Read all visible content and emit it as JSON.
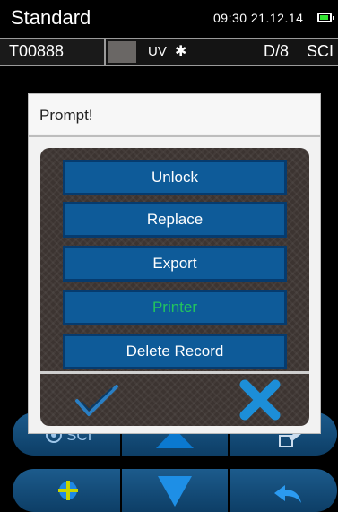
{
  "status": {
    "mode": "Standard",
    "datetime": "09:30  21.12.14",
    "battery_icon": "battery-icon"
  },
  "sample": {
    "id": "T00888",
    "swatch_color": "#6a6765",
    "uv": "UV",
    "bt_icon": "bluetooth-icon",
    "geometry": "D/8",
    "mode": "SCI"
  },
  "background_toolbar": {
    "row1": [
      "sci-mode-icon",
      "arrow-up-icon",
      "edit-icon"
    ],
    "row1_label": "SCI",
    "row2": [
      "target-icon",
      "arrow-down-icon",
      "back-arrow-icon"
    ]
  },
  "dialog": {
    "title": "Prompt!",
    "buttons": [
      {
        "label": "Unlock",
        "enabled": true
      },
      {
        "label": "Replace",
        "enabled": true
      },
      {
        "label": "Export",
        "enabled": true
      },
      {
        "label": "Printer",
        "enabled": false
      },
      {
        "label": "Delete Record",
        "enabled": true
      }
    ],
    "confirm_icon": "checkmark-icon",
    "cancel_icon": "close-x-icon"
  }
}
